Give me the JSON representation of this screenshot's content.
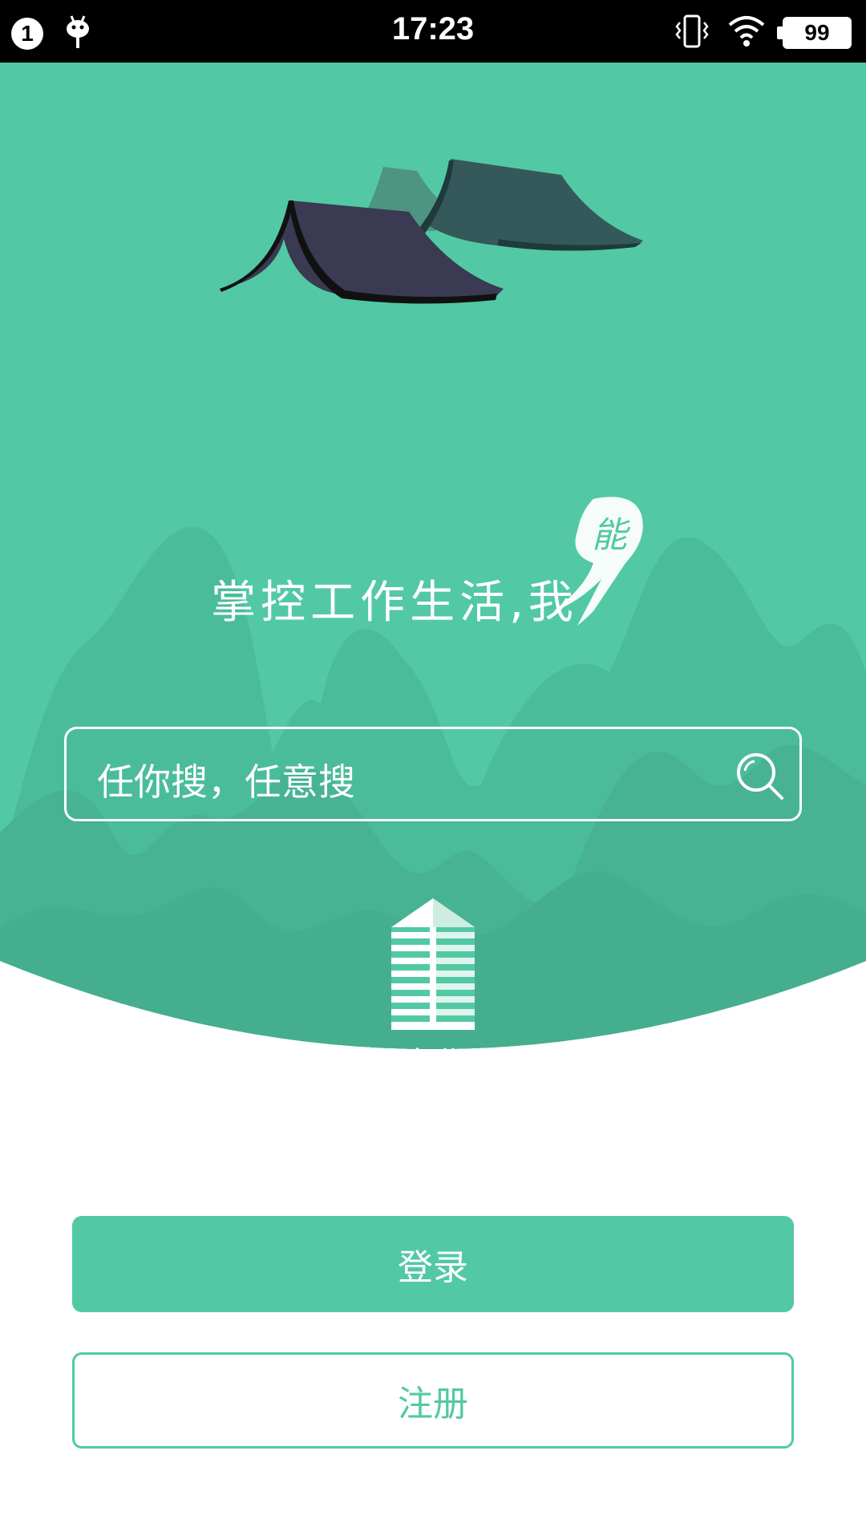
{
  "status_bar": {
    "notification_count": "1",
    "time": "17:23",
    "battery_level": "99",
    "icons": [
      "notification-badge",
      "android-debug-icon",
      "vibrate-icon",
      "wifi-icon",
      "battery-icon"
    ]
  },
  "hero": {
    "slogan_text": "掌控工作生活,我",
    "slogan_calligraphy": "能",
    "search": {
      "placeholder": "任你搜，任意搜",
      "icon": "search-icon"
    },
    "category": {
      "label": "企业",
      "icon": "building-icon"
    }
  },
  "actions": {
    "login_label": "登录",
    "register_label": "注册"
  },
  "colors": {
    "primary": "#52c9a4",
    "mountain_light": "#49b896",
    "mountain_dark": "#45b090",
    "roof_front": "#3a3a52",
    "roof_back": "#35595a"
  }
}
